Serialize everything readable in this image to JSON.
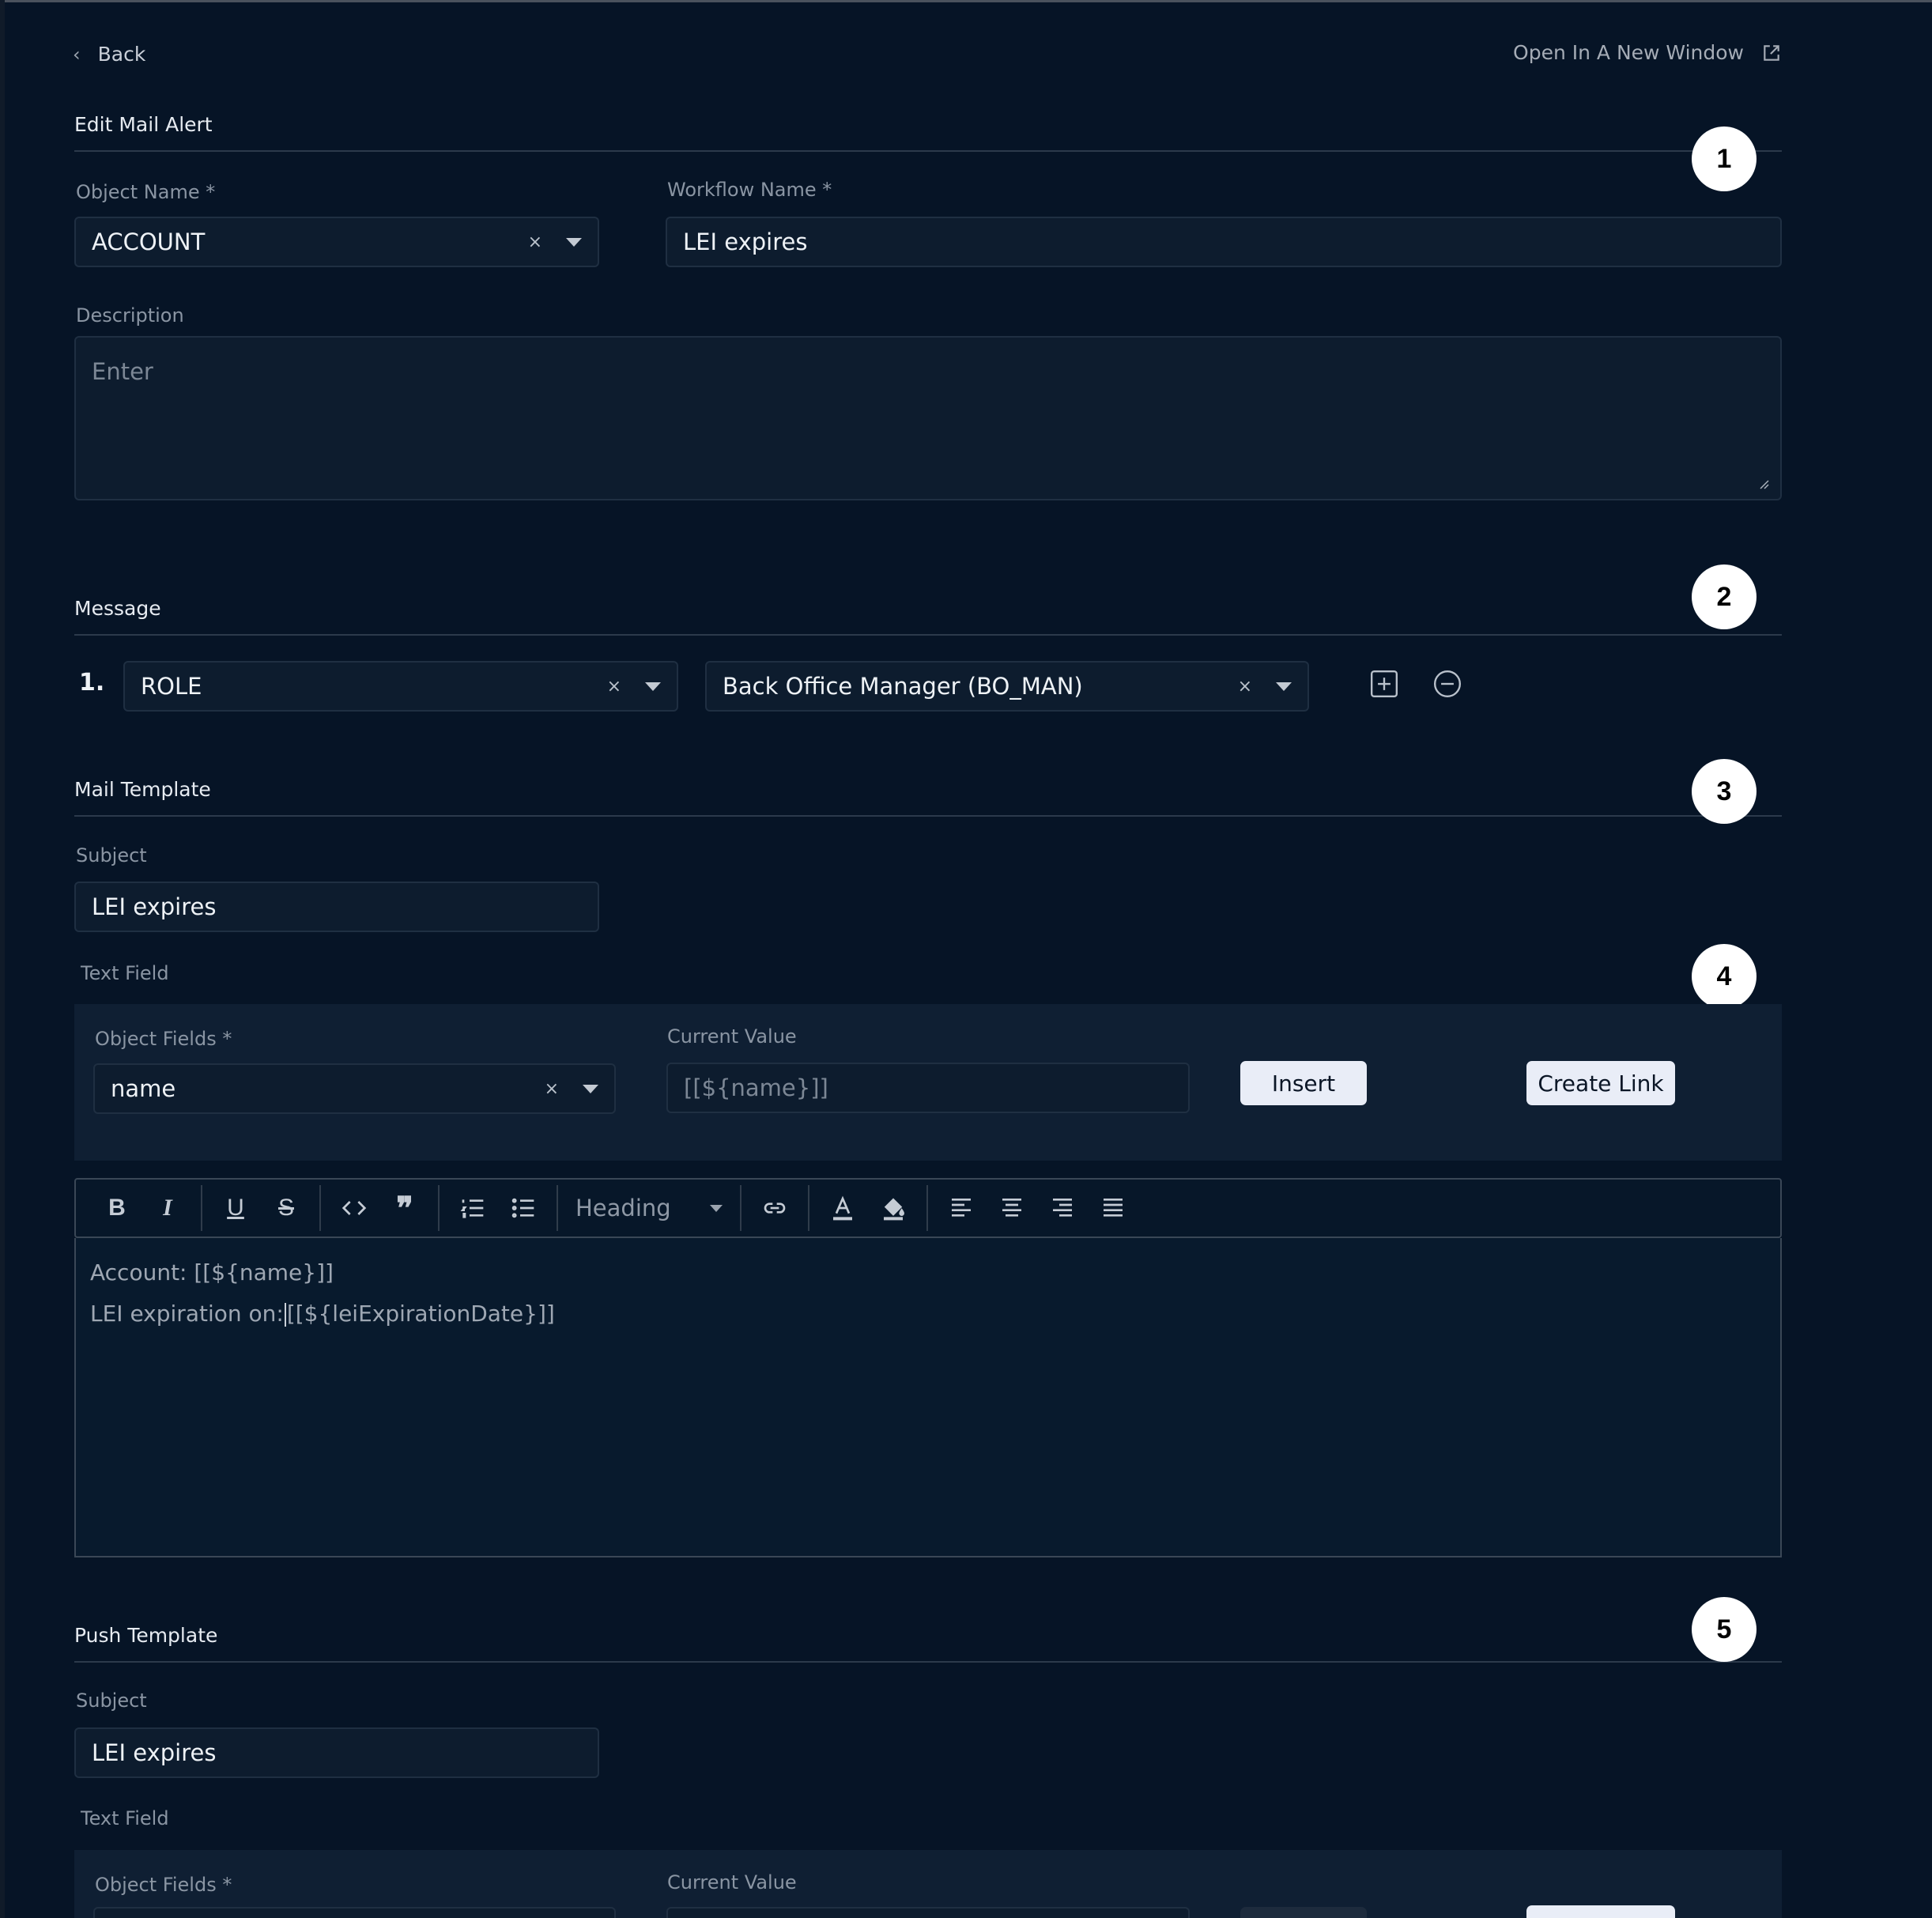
{
  "nav": {
    "back_label": "Back",
    "open_new_label": "Open In A New Window"
  },
  "sections": {
    "edit": {
      "title": "Edit Mail Alert",
      "badge": "1"
    },
    "message": {
      "title": "Message",
      "badge": "2"
    },
    "mail_template": {
      "title": "Mail Template",
      "badge": "3"
    },
    "text_field_badge": "4",
    "push_template": {
      "title": "Push Template",
      "badge": "5"
    }
  },
  "form": {
    "object_name_label": "Object Name *",
    "object_name_value": "ACCOUNT",
    "workflow_name_label": "Workflow Name *",
    "workflow_name_value": "LEI expires",
    "description_label": "Description",
    "description_placeholder": "Enter"
  },
  "message": {
    "row_number": "1.",
    "type_value": "ROLE",
    "role_value": "Back Office Manager  (BO_MAN)"
  },
  "mail_template": {
    "subject_label": "Subject",
    "subject_value": "LEI expires",
    "text_field_label": "Text Field",
    "object_fields_label": "Object Fields *",
    "object_fields_value": "name",
    "current_value_label": "Current Value",
    "current_value": "[[${name}]]",
    "insert_label": "Insert",
    "create_link_label": "Create Link",
    "heading_select": "Heading",
    "body_line1": "Account: [[${name}]]",
    "body_line2_pre": "LEI expiration on:",
    "body_line2_post": "[[${leiExpirationDate}]]"
  },
  "push_template": {
    "subject_label": "Subject",
    "subject_value": "LEI expires",
    "text_field_label": "Text Field",
    "object_fields_label": "Object Fields *",
    "current_value_label": "Current Value"
  },
  "icons": {
    "toolbar": [
      "bold-icon",
      "italic-icon",
      "underline-icon",
      "strikethrough-icon",
      "code-icon",
      "quote-icon",
      "ordered-list-icon",
      "bullet-list-icon",
      "link-icon",
      "text-color-icon",
      "fill-color-icon",
      "align-left-icon",
      "align-center-icon",
      "align-right-icon",
      "align-justify-icon"
    ]
  },
  "colors": {
    "background": "#061426",
    "field": "#0d1c2e",
    "button": "#e9edf7",
    "badge": "#ffffff"
  }
}
